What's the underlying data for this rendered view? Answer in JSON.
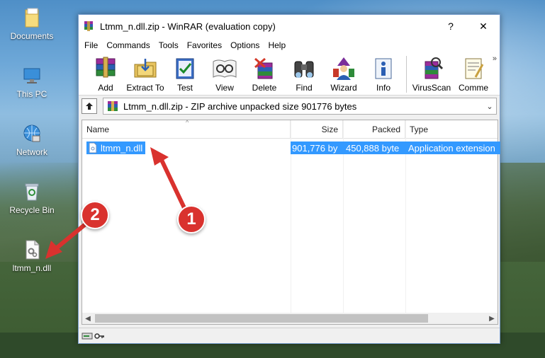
{
  "desktop": {
    "icons": [
      {
        "label": "Documents",
        "icon": "documents-folder-icon"
      },
      {
        "label": "This PC",
        "icon": "this-pc-icon"
      },
      {
        "label": "Network",
        "icon": "network-icon"
      },
      {
        "label": "Recycle Bin",
        "icon": "recycle-bin-icon"
      },
      {
        "label": "ltmm_n.dll",
        "icon": "dll-file-icon"
      }
    ]
  },
  "window": {
    "title": "Ltmm_n.dll.zip - WinRAR (evaluation copy)",
    "help_glyph": "?",
    "close_glyph": "✕",
    "menu": [
      "File",
      "Commands",
      "Tools",
      "Favorites",
      "Options",
      "Help"
    ],
    "toolbar": [
      {
        "label": "Add",
        "icon": "add-archive-icon"
      },
      {
        "label": "Extract To",
        "icon": "extract-to-icon"
      },
      {
        "label": "Test",
        "icon": "test-icon"
      },
      {
        "label": "View",
        "icon": "view-icon"
      },
      {
        "label": "Delete",
        "icon": "delete-icon"
      },
      {
        "label": "Find",
        "icon": "find-binoculars-icon"
      },
      {
        "label": "Wizard",
        "icon": "wizard-icon"
      },
      {
        "label": "Info",
        "icon": "info-icon"
      },
      {
        "label": "VirusScan",
        "icon": "virusscan-icon"
      },
      {
        "label": "Comme",
        "icon": "comment-icon"
      }
    ],
    "toolbar_overflow": "»",
    "address": "Ltmm_n.dll.zip - ZIP archive unpacked size 901776 bytes",
    "columns": [
      "Name",
      "Size",
      "Packed",
      "Type"
    ],
    "files": [
      {
        "name": "ltmm_n.dll",
        "size": "901,776 by",
        "packed": "450,888 byte",
        "type": "Application extension"
      }
    ]
  },
  "annotations": {
    "badge_1": "1",
    "badge_2": "2",
    "color": "#d9322e"
  },
  "colors": {
    "selection": "#3399ff",
    "window_border": "#7a9fcf"
  }
}
